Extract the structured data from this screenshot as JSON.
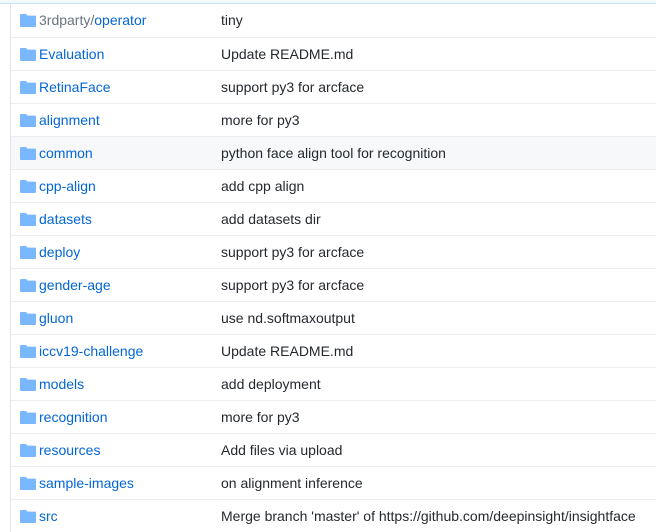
{
  "colors": {
    "link": "#0366d6",
    "text": "#24292e",
    "folder": "#79b8ff",
    "border": "#eaecef",
    "hover": "#f6f8fa"
  },
  "icons": {
    "folder": "folder-icon"
  },
  "rows": [
    {
      "name_prefix": "3rdparty/",
      "name": "operator",
      "message": "tiny"
    },
    {
      "name_prefix": "",
      "name": "Evaluation",
      "message": "Update README.md"
    },
    {
      "name_prefix": "",
      "name": "RetinaFace",
      "message": "support py3 for arcface"
    },
    {
      "name_prefix": "",
      "name": "alignment",
      "message": "more for py3"
    },
    {
      "name_prefix": "",
      "name": "common",
      "message": "python face align tool for recognition"
    },
    {
      "name_prefix": "",
      "name": "cpp-align",
      "message": "add cpp align"
    },
    {
      "name_prefix": "",
      "name": "datasets",
      "message": "add datasets dir"
    },
    {
      "name_prefix": "",
      "name": "deploy",
      "message": "support py3 for arcface"
    },
    {
      "name_prefix": "",
      "name": "gender-age",
      "message": "support py3 for arcface"
    },
    {
      "name_prefix": "",
      "name": "gluon",
      "message": "use nd.softmaxoutput"
    },
    {
      "name_prefix": "",
      "name": "iccv19-challenge",
      "message": "Update README.md"
    },
    {
      "name_prefix": "",
      "name": "models",
      "message": "add deployment"
    },
    {
      "name_prefix": "",
      "name": "recognition",
      "message": "more for py3"
    },
    {
      "name_prefix": "",
      "name": "resources",
      "message": "Add files via upload"
    },
    {
      "name_prefix": "",
      "name": "sample-images",
      "message": "on alignment inference"
    },
    {
      "name_prefix": "",
      "name": "src",
      "message": "Merge branch 'master' of https://github.com/deepinsight/insightface"
    }
  ]
}
